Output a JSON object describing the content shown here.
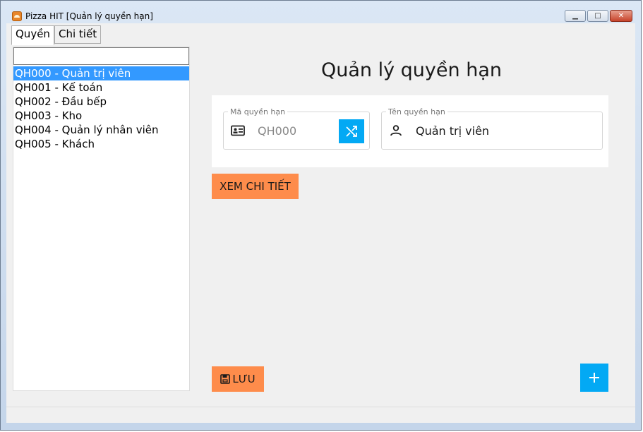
{
  "window": {
    "title": "Pizza HIT [Quản lý quyền hạn]",
    "minimize_glyph": "▁",
    "maximize_glyph": "□",
    "close_glyph": "✕"
  },
  "tabs": [
    {
      "label": "Quyền",
      "active": true
    },
    {
      "label": "Chi tiết",
      "active": false
    }
  ],
  "search": {
    "value": ""
  },
  "roles": [
    {
      "label": "QH000 - Quản trị viên",
      "selected": true
    },
    {
      "label": "QH001 - Kế toán",
      "selected": false
    },
    {
      "label": "QH002 - Đầu bếp",
      "selected": false
    },
    {
      "label": "QH003 - Kho",
      "selected": false
    },
    {
      "label": "QH004 - Quản lý nhân viên",
      "selected": false
    },
    {
      "label": "QH005 - Khách",
      "selected": false
    }
  ],
  "main": {
    "heading": "Quản lý quyền hạn",
    "code_field": {
      "label": "Mã quyền hạn",
      "value": "QH000",
      "icon": "id-card-icon"
    },
    "name_field": {
      "label": "Tên quyền hạn",
      "value": "Quản trị viên",
      "icon": "person-icon"
    },
    "random_button_icon": "shuffle-icon",
    "detail_button": "XEM CHI TIẾT",
    "save_button": "LƯU",
    "save_icon": "save-icon",
    "add_icon": "plus-icon"
  },
  "colors": {
    "accent_blue": "#03a9f4",
    "accent_orange": "#fe8c4b",
    "selection": "#3399ff"
  }
}
